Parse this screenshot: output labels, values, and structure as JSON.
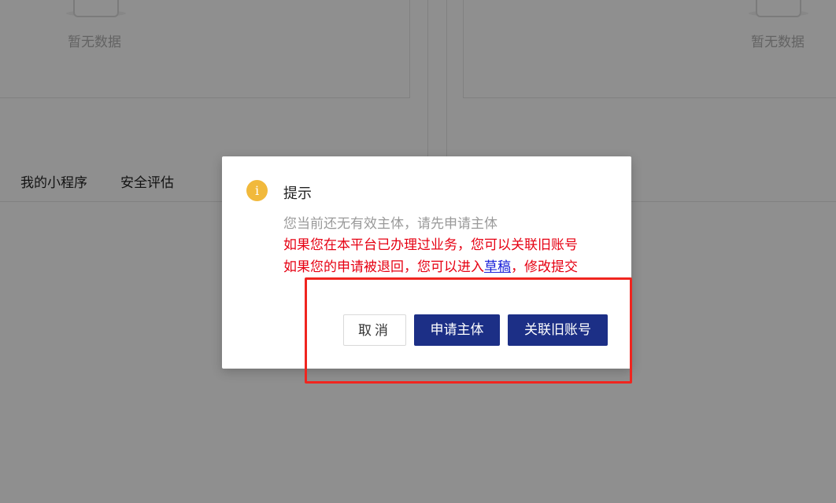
{
  "background": {
    "empty_text_left": "暂无数据",
    "empty_text_right": "暂无数据",
    "tabs": [
      {
        "label": "我的小程序"
      },
      {
        "label": "安全评估"
      }
    ]
  },
  "modal": {
    "icon": "info-icon",
    "icon_glyph": "i",
    "title": "提示",
    "line_gray": "您当前还无有效主体，请先申请主体",
    "line_red1": "如果您在本平台已办理过业务，您可以关联旧账号",
    "line_red2_prefix": "如果您的申请被退回，您可以进入",
    "line_red2_link": "草稿",
    "line_red2_suffix": "，修改提交",
    "buttons": {
      "cancel": "取消",
      "apply": "申请主体",
      "link_account": "关联旧账号"
    }
  },
  "colors": {
    "primary": "#1c2f86",
    "warning_text": "#e60012",
    "info_icon": "#f1b93c",
    "link": "#1a22d8",
    "highlight": "#f0251f"
  }
}
